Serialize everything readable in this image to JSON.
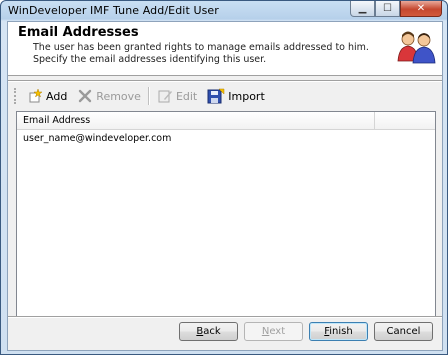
{
  "window": {
    "title": "WinDeveloper IMF Tune Add/Edit User"
  },
  "header": {
    "title": "Email Addresses",
    "description": "The user has been granted rights to manage emails addressed to him. Specify the email addresses identifying this user."
  },
  "toolbar": {
    "add_label": "Add",
    "remove_label": "Remove",
    "edit_label": "Edit",
    "import_label": "Import"
  },
  "list": {
    "columns": [
      "Email Address"
    ],
    "rows": [
      [
        "user_name@windeveloper.com"
      ]
    ]
  },
  "buttons": {
    "back_b": "B",
    "back_rest": "ack",
    "next_n": "N",
    "next_rest": "ext",
    "finish_f": "F",
    "finish_rest": "inish",
    "cancel": "Cancel"
  },
  "colors": {
    "accent": "#3c7fb1",
    "close": "#c5482f"
  },
  "icons": [
    "users-icon",
    "add-icon",
    "remove-icon",
    "edit-icon",
    "import-icon",
    "minimize-icon",
    "maximize-icon",
    "close-icon"
  ]
}
